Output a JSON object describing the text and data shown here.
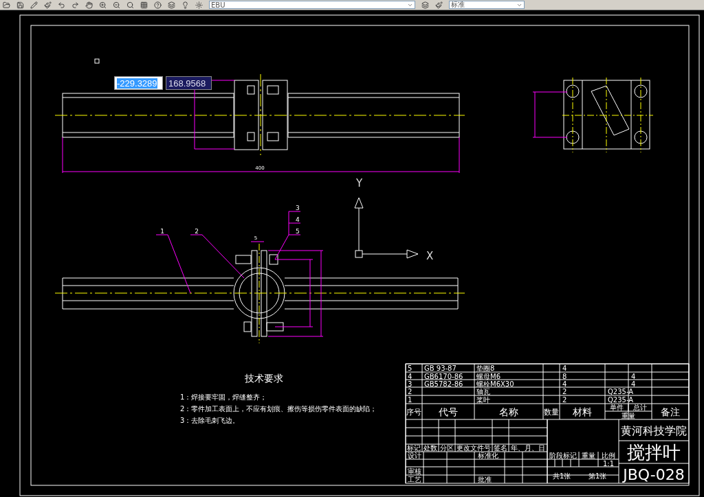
{
  "toolbar": {
    "layer_dropdown": {
      "value": "EBU"
    },
    "style_dropdown": {
      "value": "标准"
    }
  },
  "dynamic_input": [
    {
      "value": "-229.3289",
      "selected": true
    },
    {
      "value": "168.9568",
      "selected": false
    }
  ],
  "top_view": {
    "length_dimension": "400"
  },
  "front_view": {
    "width_dimension": "5",
    "leaders": [
      "1",
      "2",
      "3",
      "4",
      "5"
    ]
  },
  "ucs": {
    "y_label": "Y",
    "x_label": "X"
  },
  "technical_requirements": {
    "title": "技术要求",
    "items": [
      "1：焊接要牢固，焊缝整齐；",
      "2：零件加工表面上，不应有划痕、擦伤等损伤零件表面的缺陷；",
      "3：去除毛刺飞边。"
    ]
  },
  "parts_list": {
    "rows": [
      {
        "number": "5",
        "code": "GB 93-87",
        "name": "垫圈8",
        "quantity": "4",
        "material": "",
        "unit_weight": ""
      },
      {
        "number": "4",
        "code": "GB6170-86",
        "name": "螺母M6",
        "quantity": "8",
        "material": "",
        "unit_weight": "4"
      },
      {
        "number": "3",
        "code": "GB5782-86",
        "name": "螺栓M6X30",
        "quantity": "4",
        "material": "",
        "unit_weight": "4"
      },
      {
        "number": "2",
        "code": "",
        "name": "轴瓦",
        "quantity": "2",
        "material": "Q235-A",
        "unit_weight": ""
      },
      {
        "number": "1",
        "code": "",
        "name": "桨叶",
        "quantity": "2",
        "material": "Q235-A",
        "unit_weight": ""
      }
    ],
    "header": {
      "number": "序号",
      "code": "代号",
      "name": "名称",
      "quantity": "数量",
      "material": "材料",
      "unit": "单件",
      "total": "总计",
      "weight": "重量",
      "remarks": "备注"
    }
  },
  "title_block": {
    "revision_labels": [
      "标记",
      "处数",
      "分区",
      "更改文件号",
      "签名",
      "年、月、日"
    ],
    "design": "设计",
    "standardization": "标准化",
    "review": "审核",
    "process": "工艺",
    "approval": "批准",
    "stage_mark": "阶段标记",
    "weight": "重量",
    "scale": "比例",
    "scale_value": "1:1",
    "sheet_total": "共1张",
    "sheet_number": "第1张",
    "school": "黄河科技学院",
    "part_name": "搅拌叶",
    "drawing_number": "JBQ-028"
  }
}
